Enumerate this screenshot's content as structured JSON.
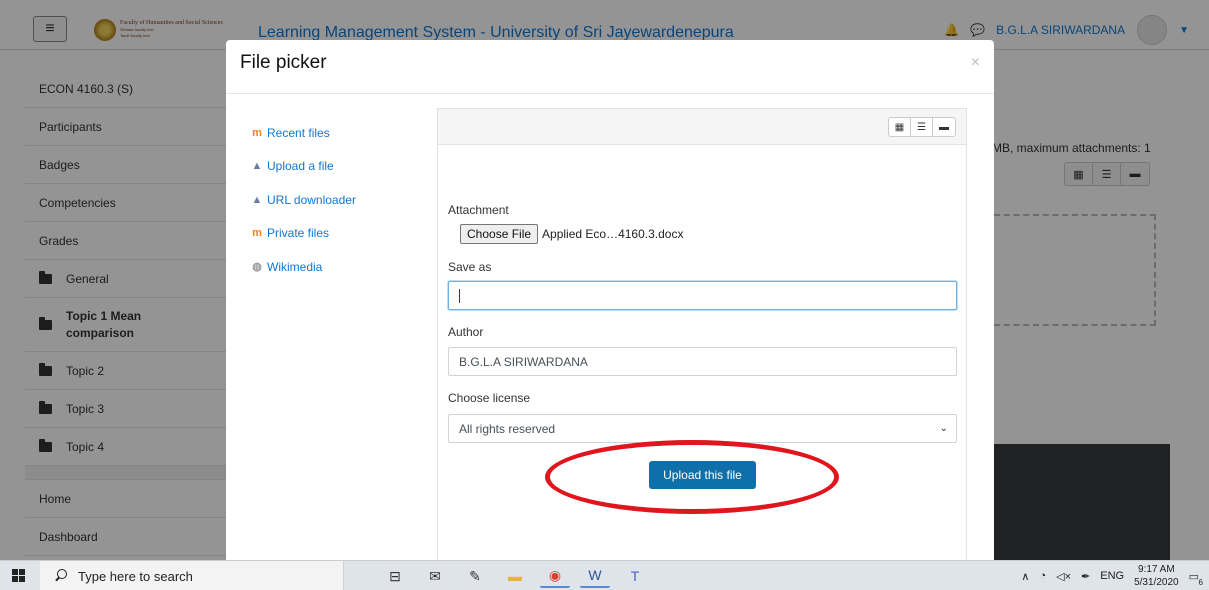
{
  "navbar": {
    "menu_icon": "hamburger-icon",
    "logo": {
      "line1": "Faculty of Humanities and Social Sciences",
      "line2": "Sinhala faculty text",
      "line3": "Tamil faculty text"
    },
    "site_title": "Learning Management System - University of Sri Jayewardenepura",
    "user_name": "B.G.L.A SIRIWARDANA"
  },
  "sidebar": {
    "course": "ECON 4160.3 (S)",
    "items": [
      "Participants",
      "Badges",
      "Competencies",
      "Grades"
    ],
    "sections": [
      "General",
      "Topic 1 Mean comparison",
      "Topic 2",
      "Topic 3",
      "Topic 4"
    ],
    "bottom": [
      "Home",
      "Dashboard"
    ]
  },
  "background_page": {
    "limits_note": "MB, maximum attachments: 1"
  },
  "file_picker": {
    "title": "File picker",
    "close_symbol": "×",
    "repositories": [
      {
        "label": "Recent files",
        "icon": "moodle-icon"
      },
      {
        "label": "Upload a file",
        "icon": "upload-icon"
      },
      {
        "label": "URL downloader",
        "icon": "upload-icon"
      },
      {
        "label": "Private files",
        "icon": "moodle-icon"
      },
      {
        "label": "Wikimedia",
        "icon": "wikimedia-icon"
      }
    ],
    "form": {
      "attachment_label": "Attachment",
      "choose_file_label": "Choose File",
      "chosen_file": "Applied Eco…4160.3.docx",
      "save_as_label": "Save as",
      "save_as_value": "",
      "author_label": "Author",
      "author_value": "B.G.L.A SIRIWARDANA",
      "license_label": "Choose license",
      "license_value": "All rights reserved",
      "upload_button": "Upload this file"
    }
  },
  "taskbar": {
    "search_placeholder": "Type here to search",
    "language": "ENG",
    "time": "9:17 AM",
    "date": "5/31/2020",
    "notification_count": "6"
  },
  "colors": {
    "link": "#1177d1",
    "primary_button": "#0f6fa8",
    "highlight": "#e0161e"
  }
}
